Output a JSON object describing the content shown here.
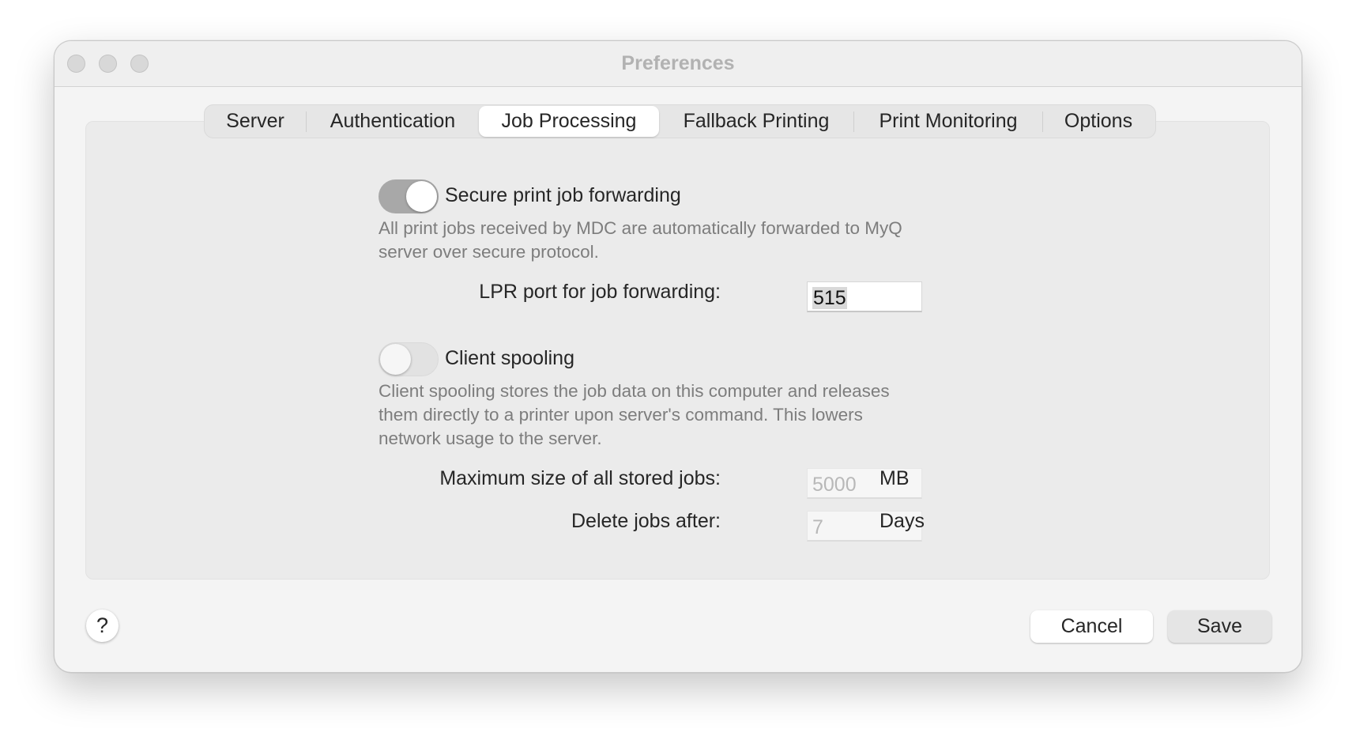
{
  "window": {
    "title": "Preferences",
    "traffic_lights": [
      "close",
      "minimize",
      "zoom"
    ]
  },
  "tabs": [
    {
      "label": "Server",
      "active": false
    },
    {
      "label": "Authentication",
      "active": false
    },
    {
      "label": "Job Processing",
      "active": true
    },
    {
      "label": "Fallback Printing",
      "active": false
    },
    {
      "label": "Print Monitoring",
      "active": false
    },
    {
      "label": "Options",
      "active": false
    }
  ],
  "secure_forwarding": {
    "label": "Secure print job forwarding",
    "enabled": true,
    "description_line1": "All print jobs received by MDC are automatically forwarded to MyQ",
    "description_line2": "server over secure protocol.",
    "lpr_port_label": "LPR port for job forwarding:",
    "lpr_port_value": "515"
  },
  "client_spooling": {
    "label": "Client spooling",
    "enabled": false,
    "description_line1": "Client spooling stores the job data on this computer and releases",
    "description_line2": "them directly to a printer upon server's command. This lowers",
    "description_line3": "network usage to the server.",
    "max_size_label": "Maximum size of all stored jobs:",
    "max_size_value": "5000",
    "max_size_unit": "MB",
    "delete_after_label": "Delete jobs after:",
    "delete_after_value": "7",
    "delete_after_unit": "Days"
  },
  "footer": {
    "help_label": "?",
    "cancel_label": "Cancel",
    "save_label": "Save"
  }
}
